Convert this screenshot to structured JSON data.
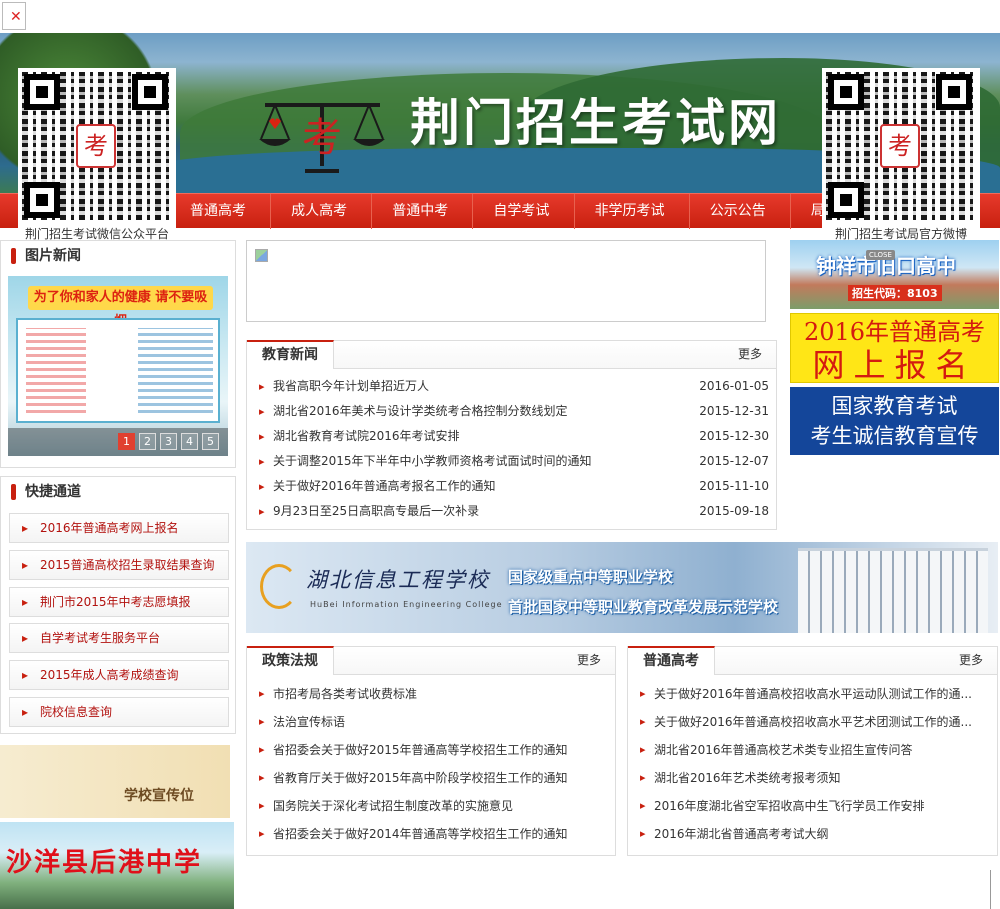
{
  "site": {
    "title": "荆门招生考试网",
    "logo_char": "考"
  },
  "nav": {
    "items": [
      "普通高考",
      "成人高考",
      "普通中考",
      "自学考试",
      "非学历考试",
      "公示公告",
      "局长信"
    ]
  },
  "qr_left": {
    "caption": "荆门招生考试微信公众平台"
  },
  "qr_right": {
    "caption": "荆门招生考试局官方微博"
  },
  "close_label": "CLOSE",
  "photo_news": {
    "title": "图片新闻",
    "slide_caption": "为了你和家人的健康  请不要吸烟",
    "pages": [
      "1",
      "2",
      "3",
      "4",
      "5"
    ]
  },
  "quick": {
    "title": "快捷通道",
    "items": [
      "2016年普通高考网上报名",
      "2015普通高校招生录取结果查询",
      "荆门市2015年中考志愿填报",
      "自学考试考生服务平台",
      "2015年成人高考成绩查询",
      "院校信息查询"
    ]
  },
  "promo_left": {
    "school_ad": "学校宣传位",
    "school_name": "沙洋县后港中学"
  },
  "edu_news": {
    "title": "教育新闻",
    "more": "更多",
    "items": [
      {
        "text": "我省高职今年计划单招近万人",
        "date": "2016-01-05"
      },
      {
        "text": "湖北省2016年美术与设计学类统考合格控制分数线划定",
        "date": "2015-12-31"
      },
      {
        "text": "湖北省教育考试院2016年考试安排",
        "date": "2015-12-30"
      },
      {
        "text": "关于调整2015年下半年中小学教师资格考试面试时间的通知",
        "date": "2015-12-07"
      },
      {
        "text": "关于做好2016年普通高考报名工作的通知",
        "date": "2015-11-10"
      },
      {
        "text": "9月23日至25日高职高专最后一次补录",
        "date": "2015-09-18"
      }
    ]
  },
  "mid_ad": {
    "school_cn": "湖北信息工程学校",
    "school_en": "HuBei Information Engineering College",
    "line1": "国家级重点中等职业学校",
    "line2": "首批国家中等职业教育改革发展示范学校"
  },
  "policy": {
    "title": "政策法规",
    "more": "更多",
    "items": [
      "市招考局各类考试收费标准",
      "法治宣传标语",
      "省招委会关于做好2015年普通高等学校招生工作的通知",
      "省教育厅关于做好2015年高中阶段学校招生工作的通知",
      "国务院关于深化考试招生制度改革的实施意见",
      "省招委会关于做好2014年普通高等学校招生工作的通知"
    ]
  },
  "gaokao": {
    "title": "普通高考",
    "more": "更多",
    "items": [
      "关于做好2016年普通高校招收高水平运动队测试工作的通...",
      "关于做好2016年普通高校招收高水平艺术团测试工作的通...",
      "湖北省2016年普通高校艺术类专业招生宣传问答",
      "湖北省2016年艺术类统考报考须知",
      "2016年度湖北省空军招收高中生飞行学员工作安排",
      "2016年湖北省普通高考考试大纲"
    ]
  },
  "right_ads": {
    "ad1_title": "钟祥市旧口高中",
    "ad1_code": "招生代码：8103",
    "ad2_line1": "2016年普通高考",
    "ad2_line2": "网上报名",
    "ad3_line1": "国家教育考试",
    "ad3_line2": "考生诚信教育宣传"
  },
  "colors": {
    "nav_red": "#c8200f",
    "link_red": "#b2120f",
    "ad_blue": "#14469a",
    "ad_yellow": "#ffe616"
  }
}
